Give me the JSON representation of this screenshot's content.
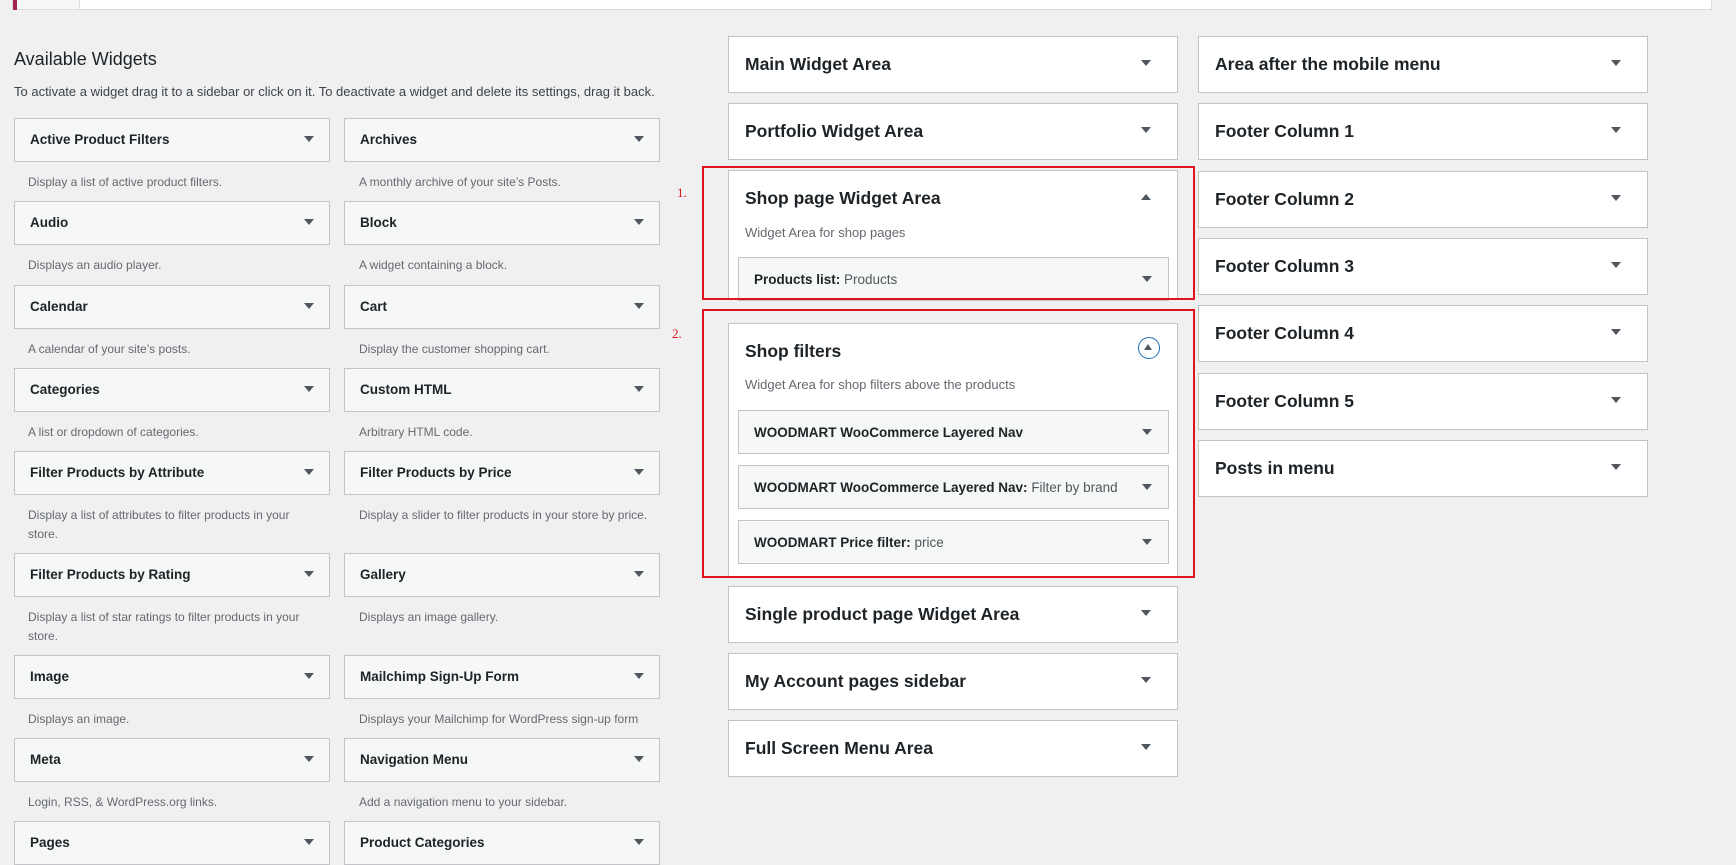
{
  "available_widgets": {
    "title": "Available Widgets",
    "description": "To activate a widget drag it to a sidebar or click on it. To deactivate a widget and delete its settings, drag it back.",
    "items": [
      {
        "title": "Active Product Filters",
        "desc": "Display a list of active product filters."
      },
      {
        "title": "Archives",
        "desc": "A monthly archive of your site’s Posts."
      },
      {
        "title": "Audio",
        "desc": "Displays an audio player."
      },
      {
        "title": "Block",
        "desc": "A widget containing a block."
      },
      {
        "title": "Calendar",
        "desc": "A calendar of your site’s posts."
      },
      {
        "title": "Cart",
        "desc": "Display the customer shopping cart."
      },
      {
        "title": "Categories",
        "desc": "A list or dropdown of categories."
      },
      {
        "title": "Custom HTML",
        "desc": "Arbitrary HTML code."
      },
      {
        "title": "Filter Products by Attribute",
        "desc": "Display a list of attributes to filter products in your store."
      },
      {
        "title": "Filter Products by Price",
        "desc": "Display a slider to filter products in your store by price."
      },
      {
        "title": "Filter Products by Rating",
        "desc": "Display a list of star ratings to filter products in your store."
      },
      {
        "title": "Gallery",
        "desc": "Displays an image gallery."
      },
      {
        "title": "Image",
        "desc": "Displays an image."
      },
      {
        "title": "Mailchimp Sign-Up Form",
        "desc": "Displays your Mailchimp for WordPress sign-up form"
      },
      {
        "title": "Meta",
        "desc": "Login, RSS, & WordPress.org links."
      },
      {
        "title": "Navigation Menu",
        "desc": "Add a navigation menu to your sidebar."
      },
      {
        "title": "Pages",
        "desc": ""
      },
      {
        "title": "Product Categories",
        "desc": ""
      }
    ]
  },
  "areas_middle": [
    {
      "title": "Main Widget Area"
    },
    {
      "title": "Portfolio Widget Area"
    },
    {
      "title": "Shop page Widget Area",
      "subtitle": "Widget Area for shop pages",
      "widgets": [
        {
          "name": "Products list:",
          "extra": "Products"
        }
      ]
    },
    {
      "title": "Shop filters",
      "subtitle": "Widget Area for shop filters above the products",
      "widgets": [
        {
          "name": "WOODMART WooCommerce Layered Nav",
          "extra": ""
        },
        {
          "name": "WOODMART WooCommerce Layered Nav:",
          "extra": "Filter by brand"
        },
        {
          "name": "WOODMART Price filter:",
          "extra": "price"
        }
      ]
    },
    {
      "title": "Single product page Widget Area"
    },
    {
      "title": "My Account pages sidebar"
    },
    {
      "title": "Full Screen Menu Area"
    }
  ],
  "areas_right": [
    {
      "title": "Area after the mobile menu"
    },
    {
      "title": "Footer Column 1"
    },
    {
      "title": "Footer Column 2"
    },
    {
      "title": "Footer Column 3"
    },
    {
      "title": "Footer Column 4"
    },
    {
      "title": "Footer Column 5"
    },
    {
      "title": "Posts in menu"
    }
  ],
  "annotations": [
    "1.",
    "2."
  ],
  "colors": {
    "highlight": "#e0141e",
    "accent": "#2271b1"
  }
}
